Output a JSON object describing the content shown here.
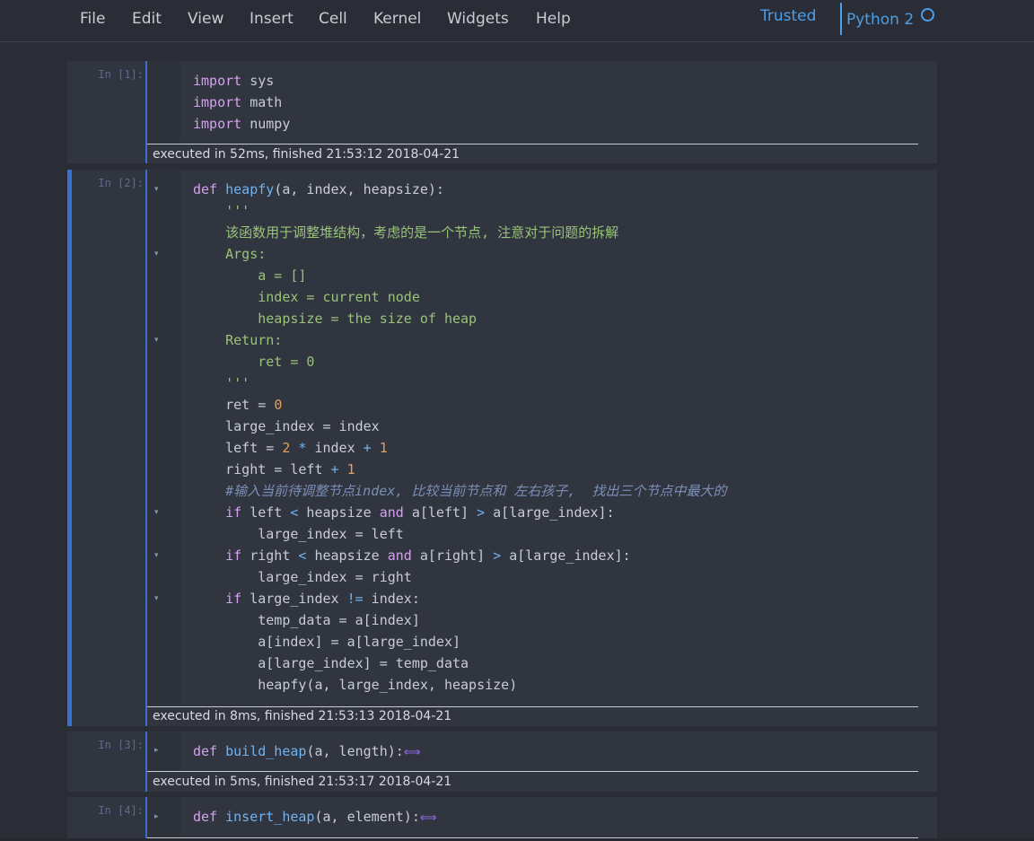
{
  "menu": {
    "file": "File",
    "edit": "Edit",
    "view": "View",
    "insert": "Insert",
    "cell": "Cell",
    "kernel": "Kernel",
    "widgets": "Widgets",
    "help": "Help"
  },
  "status": {
    "trusted": "Trusted",
    "kernel_name": "Python 2"
  },
  "cells": [
    {
      "prompt": "In [1]:",
      "executed": "executed in 52ms, finished 21:53:12 2018-04-21"
    },
    {
      "prompt": "In [2]:",
      "executed": "executed in 8ms, finished 21:53:13 2018-04-21"
    },
    {
      "prompt": "In [3]:",
      "executed": "executed in 5ms, finished 21:53:17 2018-04-21"
    },
    {
      "prompt": "In [4]:"
    }
  ],
  "code": {
    "c1": {
      "l1": "sys",
      "l2": "math",
      "l3": "numpy"
    },
    "c2": {
      "fname": "heapfy",
      "params": "(a, index, heapsize):",
      "doc_open": "'''",
      "doc_desc": "该函数用于调整堆结构，考虑的是一个节点, 注意对于问题的拆解",
      "args": "Args:",
      "a": "a = []",
      "index": "index = current node",
      "heapsize": "heapsize = the size of heap",
      "ret_hdr": "Return:",
      "ret_doc": "ret = 0",
      "doc_close": "'''",
      "comment": "#输入当前待调整节点index, 比较当前节点和 左右孩子,  找出三个节点中最大的"
    },
    "c3": {
      "fname": "build_heap",
      "params": "(a, length):"
    },
    "c4": {
      "fname": "insert_heap",
      "params": "(a, element):"
    }
  },
  "icons": {
    "fold_open": "fold-open-icon",
    "fold_closed": "fold-closed-icon",
    "ellipsis": "collapsed-ellipsis-icon"
  },
  "colors": {
    "accent": "#3a6fd0",
    "trusted": "#4c9ee8",
    "keyword": "#d4a0f0",
    "function": "#6fb3f2",
    "string": "#98c379",
    "number": "#e5a05a"
  }
}
